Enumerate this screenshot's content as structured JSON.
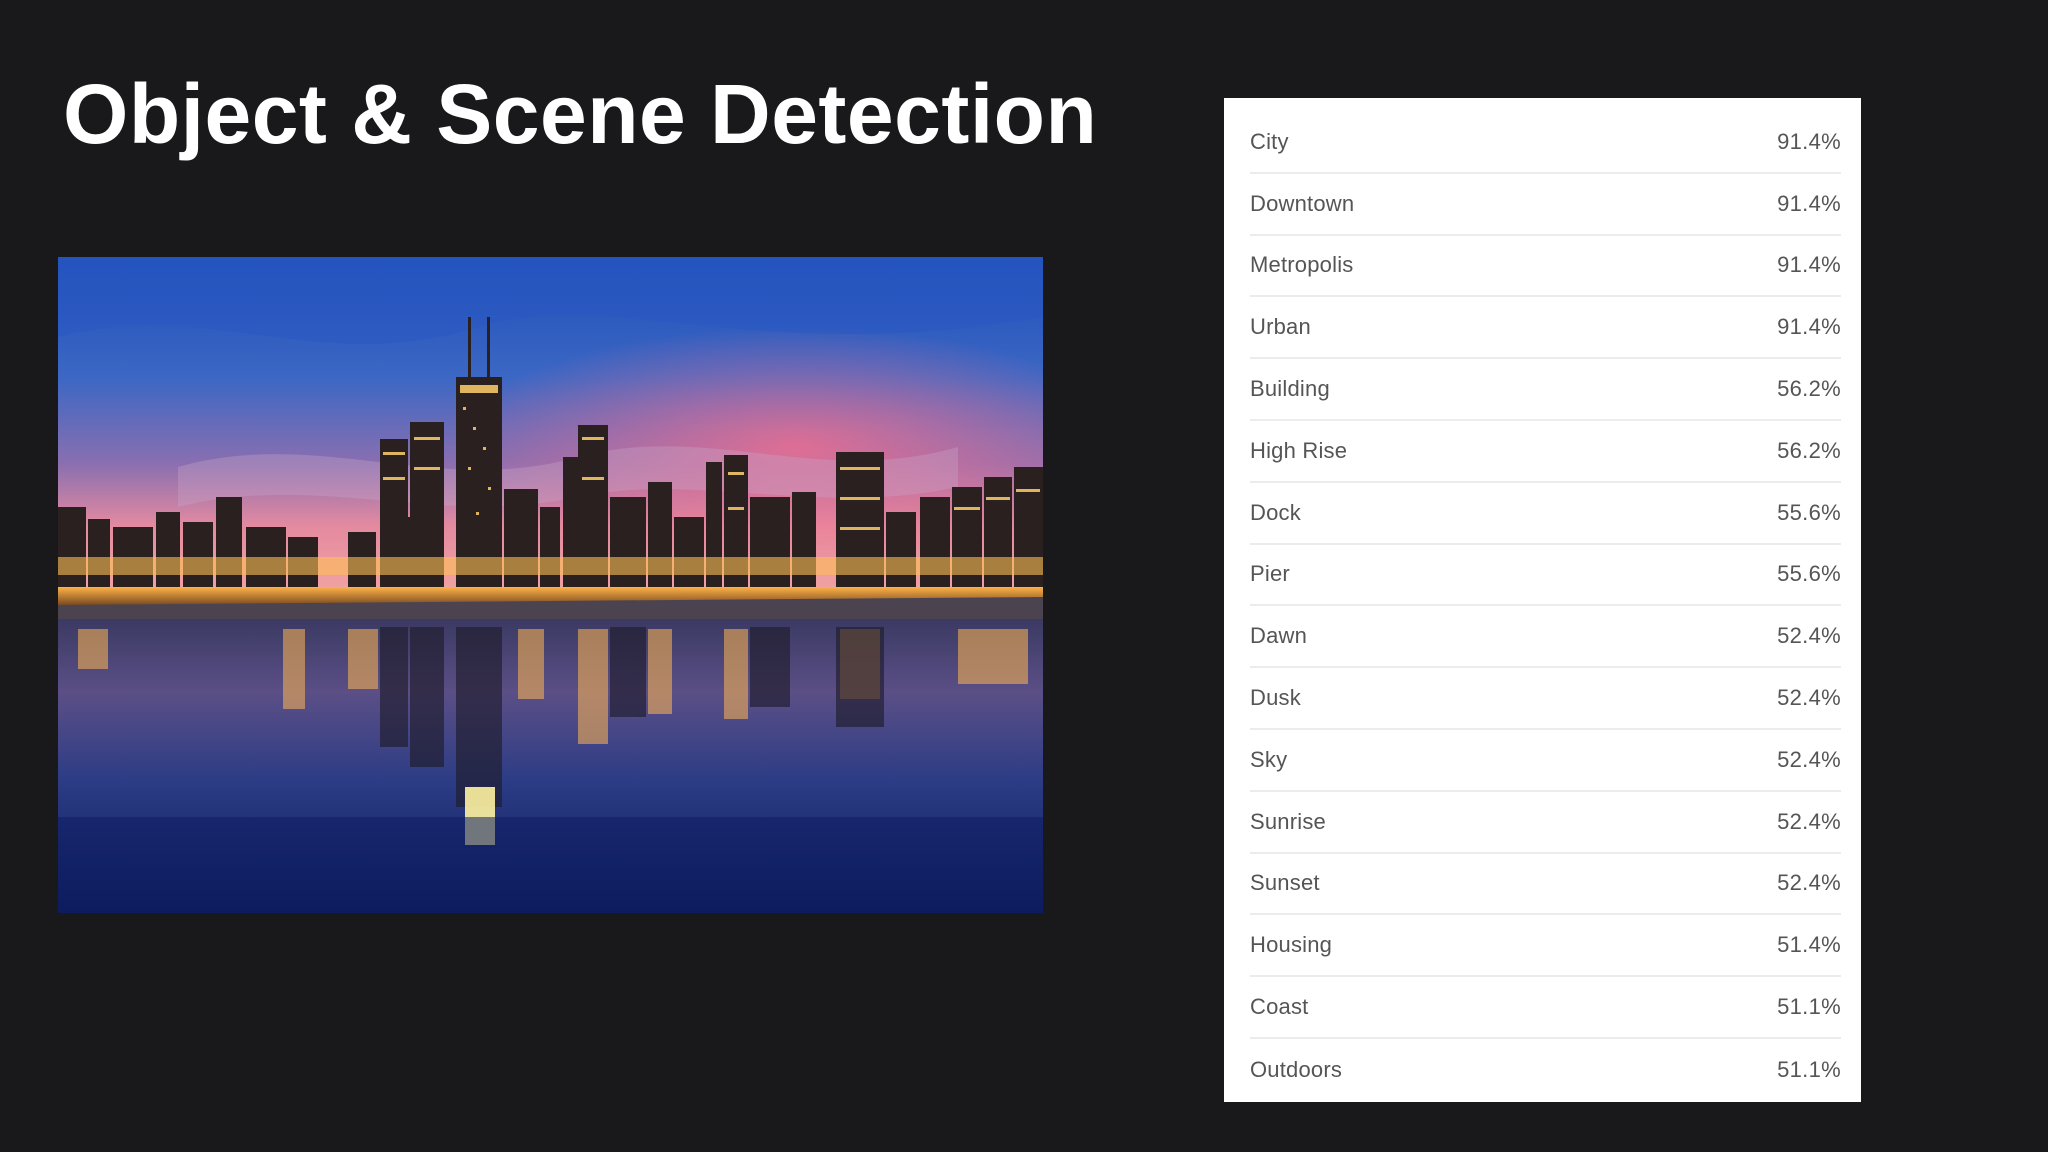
{
  "slide": {
    "title": "Object & Scene Detection"
  },
  "photo": {
    "description_icon": "city-skyline-at-dusk-photo"
  },
  "results": [
    {
      "label": "City",
      "value": "91.4%"
    },
    {
      "label": "Downtown",
      "value": "91.4%"
    },
    {
      "label": "Metropolis",
      "value": "91.4%"
    },
    {
      "label": "Urban",
      "value": "91.4%"
    },
    {
      "label": "Building",
      "value": "56.2%"
    },
    {
      "label": "High Rise",
      "value": "56.2%"
    },
    {
      "label": "Dock",
      "value": "55.6%"
    },
    {
      "label": "Pier",
      "value": "55.6%"
    },
    {
      "label": "Dawn",
      "value": "52.4%"
    },
    {
      "label": "Dusk",
      "value": "52.4%"
    },
    {
      "label": "Sky",
      "value": "52.4%"
    },
    {
      "label": "Sunrise",
      "value": "52.4%"
    },
    {
      "label": "Sunset",
      "value": "52.4%"
    },
    {
      "label": "Housing",
      "value": "51.4%"
    },
    {
      "label": "Coast",
      "value": "51.1%"
    },
    {
      "label": "Outdoors",
      "value": "51.1%"
    }
  ],
  "colors": {
    "background": "#19181a",
    "title": "#ffffff",
    "panel": "#ffffff",
    "row_text": "#555555",
    "row_divider": "#ececec"
  }
}
